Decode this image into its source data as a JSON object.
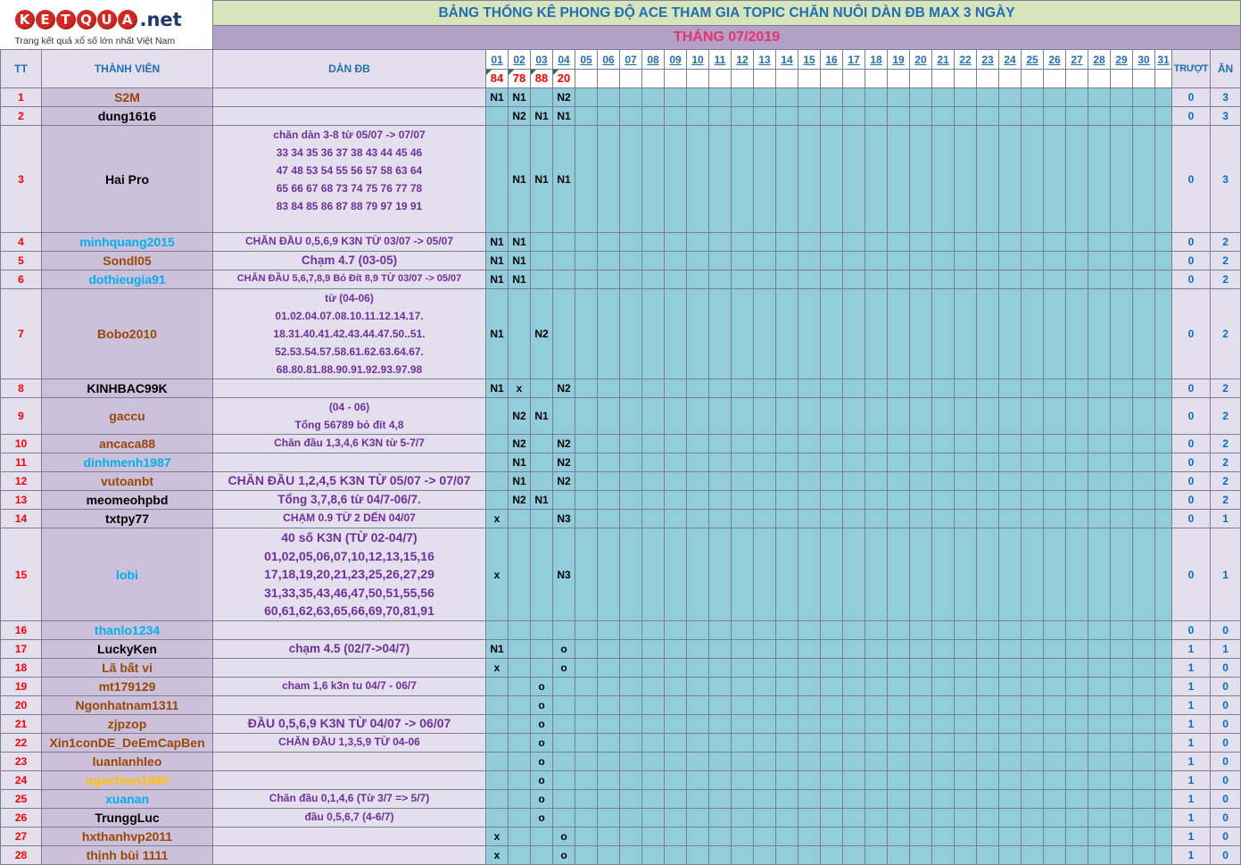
{
  "logo": {
    "letters": [
      "K",
      "E",
      "T",
      "Q",
      "U",
      "A"
    ],
    "tld": ".net",
    "tagline": "Trang kết quả xổ số lớn nhất Việt Nam"
  },
  "title": "BẢNG THỐNG KÊ PHONG ĐỘ ACE THAM GIA TOPIC CHĂN NUÔI DÀN ĐB MAX 3 NGÀY",
  "month": "THÁNG 07/2019",
  "headers": {
    "tt": "TT",
    "member": "THÀNH VIÊN",
    "dan": "DÀN ĐB",
    "miss": "TRƯỢT",
    "hit": "ĂN"
  },
  "days": [
    "01",
    "02",
    "03",
    "04",
    "05",
    "06",
    "07",
    "08",
    "09",
    "10",
    "11",
    "12",
    "13",
    "14",
    "15",
    "16",
    "17",
    "18",
    "19",
    "20",
    "21",
    "22",
    "23",
    "24",
    "25",
    "26",
    "27",
    "28",
    "29",
    "30",
    "31"
  ],
  "results": [
    "84",
    "78",
    "88",
    "20"
  ],
  "rows": [
    {
      "tt": "1",
      "member": "S2M",
      "color": "#984807",
      "dan": [],
      "marks": [
        "N1",
        "N1",
        "",
        "N2"
      ],
      "miss": "0",
      "hit": "3"
    },
    {
      "tt": "2",
      "member": "dung1616",
      "color": "#000000",
      "dan": [],
      "marks": [
        "",
        "N2",
        "N1",
        "N1"
      ],
      "miss": "0",
      "hit": "3"
    },
    {
      "tt": "3",
      "member": "Hai Pro",
      "color": "#000000",
      "dan": [
        "chăn dàn 3-8 từ 05/07 -> 07/07",
        "33 34 35 36 37 38 43 44 45 46",
        "47 48 53 54 55 56 57 58 63 64",
        "65 66 67 68 73 74 75 76 77 78",
        "83 84 85 86 87 88 79 97 19 91"
      ],
      "marks": [
        "",
        "N1",
        "N1",
        "N1"
      ],
      "miss": "0",
      "hit": "3"
    },
    {
      "tt": "4",
      "member": "minhquang2015",
      "color": "#00b0f0",
      "dan": [
        "CHĂN ĐẦU 0,5,6,9 K3N TỪ 03/07 -> 05/07"
      ],
      "marks": [
        "N1",
        "N1",
        "",
        ""
      ],
      "miss": "0",
      "hit": "2"
    },
    {
      "tt": "5",
      "member": "Sondl05",
      "color": "#984807",
      "dan": [
        "Chạm 4.7 (03-05)"
      ],
      "marks": [
        "N1",
        "N1",
        "",
        ""
      ],
      "miss": "0",
      "hit": "2"
    },
    {
      "tt": "6",
      "member": "dothieugia91",
      "color": "#00b0f0",
      "dan": [
        "CHĂN ĐẦU 5,6,7,8,9 Bỏ Đít 8,9 TỪ 03/07 -> 05/07"
      ],
      "marks": [
        "N1",
        "N1",
        "",
        ""
      ],
      "miss": "0",
      "hit": "2"
    },
    {
      "tt": "7",
      "member": "Bobo2010",
      "color": "#984807",
      "dan": [
        "từ (04-06)",
        "01.02.04.07.08.10.11.12.14.17.",
        "18.31.40.41.42.43.44.47.50..51.",
        "52.53.54.57.58.61.62.63.64.67.",
        "68.80.81.88.90.91.92.93.97.98"
      ],
      "marks": [
        "N1",
        "",
        "N2",
        ""
      ],
      "miss": "0",
      "hit": "2"
    },
    {
      "tt": "8",
      "member": "KINHBAC99K",
      "color": "#000000",
      "dan": [],
      "marks": [
        "N1",
        "x",
        "",
        "N2"
      ],
      "miss": "0",
      "hit": "2"
    },
    {
      "tt": "9",
      "member": "gaccu",
      "color": "#984807",
      "dan": [
        "(04 - 06)",
        "Tổng 56789 bỏ đít 4,8"
      ],
      "marks": [
        "",
        "N2",
        "N1",
        ""
      ],
      "miss": "0",
      "hit": "2"
    },
    {
      "tt": "10",
      "member": "ancaca88",
      "color": "#984807",
      "dan": [
        "Chăn đầu 1,3,4,6 K3N từ 5-7/7"
      ],
      "marks": [
        "",
        "N2",
        "",
        "N2"
      ],
      "miss": "0",
      "hit": "2"
    },
    {
      "tt": "11",
      "member": "dinhmenh1987",
      "color": "#00b0f0",
      "dan": [],
      "marks": [
        "",
        "N1",
        "",
        "N2"
      ],
      "miss": "0",
      "hit": "2"
    },
    {
      "tt": "12",
      "member": "vutoanbt",
      "color": "#984807",
      "dan": [
        "CHĂN ĐẦU 1,2,4,5 K3N TỪ 05/07 -> 07/07"
      ],
      "marks": [
        "",
        "N1",
        "",
        "N2"
      ],
      "miss": "0",
      "hit": "2"
    },
    {
      "tt": "13",
      "member": "meomeohpbd",
      "color": "#000000",
      "dan": [
        "Tổng 3,7,8,6 từ 04/7-06/7."
      ],
      "marks": [
        "",
        "N2",
        "N1",
        ""
      ],
      "miss": "0",
      "hit": "2"
    },
    {
      "tt": "14",
      "member": "txtpy77",
      "color": "#000000",
      "dan": [
        "CHẠM 0.9 TỪ 2 DẾN 04/07"
      ],
      "marks": [
        "x",
        "",
        "",
        "N3"
      ],
      "miss": "0",
      "hit": "1"
    },
    {
      "tt": "15",
      "member": "lobi",
      "color": "#00b0f0",
      "dan": [
        "40 số K3N (TỪ 02-04/7)",
        "01,02,05,06,07,10,12,13,15,16",
        "17,18,19,20,21,23,25,26,27,29",
        "31,33,35,43,46,47,50,51,55,56",
        "60,61,62,63,65,66,69,70,81,91"
      ],
      "marks": [
        "x",
        "",
        "",
        "N3"
      ],
      "miss": "0",
      "hit": "1"
    },
    {
      "tt": "16",
      "member": "thanlo1234",
      "color": "#00b0f0",
      "dan": [],
      "marks": [
        "",
        "",
        "",
        ""
      ],
      "miss": "0",
      "hit": "0"
    },
    {
      "tt": "17",
      "member": "LuckyKen",
      "color": "#000000",
      "dan": [
        "chạm 4.5 (02/7->04/7)"
      ],
      "marks": [
        "N1",
        "",
        "",
        "o"
      ],
      "miss": "1",
      "hit": "1"
    },
    {
      "tt": "18",
      "member": "Lã bất vi",
      "color": "#984807",
      "dan": [],
      "marks": [
        "x",
        "",
        "",
        "o"
      ],
      "miss": "1",
      "hit": "0"
    },
    {
      "tt": "19",
      "member": "mt179129",
      "color": "#984807",
      "dan": [
        "cham 1,6 k3n tu 04/7 - 06/7"
      ],
      "marks": [
        "",
        "",
        "o",
        ""
      ],
      "miss": "1",
      "hit": "0"
    },
    {
      "tt": "20",
      "member": "Ngonhatnam1311",
      "color": "#984807",
      "dan": [],
      "marks": [
        "",
        "",
        "o",
        ""
      ],
      "miss": "1",
      "hit": "0"
    },
    {
      "tt": "21",
      "member": "zjpzop",
      "color": "#984807",
      "dan": [
        "ĐẦU 0,5,6,9 K3N TỪ 04/07 -> 06/07"
      ],
      "marks": [
        "",
        "",
        "o",
        ""
      ],
      "miss": "1",
      "hit": "0"
    },
    {
      "tt": "22",
      "member": "Xin1conDE_DeEmCapBen",
      "color": "#984807",
      "dan": [
        "CHĂN ĐẦU 1,3,5,9 TỪ 04-06"
      ],
      "marks": [
        "",
        "",
        "o",
        ""
      ],
      "miss": "1",
      "hit": "0"
    },
    {
      "tt": "23",
      "member": "luanlanhleo",
      "color": "#984807",
      "dan": [],
      "marks": [
        "",
        "",
        "o",
        ""
      ],
      "miss": "1",
      "hit": "0"
    },
    {
      "tt": "24",
      "member": "ngochien1980",
      "color": "#ffc000",
      "dan": [],
      "marks": [
        "",
        "",
        "o",
        ""
      ],
      "miss": "1",
      "hit": "0"
    },
    {
      "tt": "25",
      "member": "xuanan",
      "color": "#00b0f0",
      "dan": [
        "Chăn đầu 0,1,4,6 (Từ 3/7 => 5/7)"
      ],
      "marks": [
        "",
        "",
        "o",
        ""
      ],
      "miss": "1",
      "hit": "0"
    },
    {
      "tt": "26",
      "member": "TrunggLuc",
      "color": "#000000",
      "dan": [
        "đầu 0,5,6,7 (4-6/7)"
      ],
      "marks": [
        "",
        "",
        "o",
        ""
      ],
      "miss": "1",
      "hit": "0"
    },
    {
      "tt": "27",
      "member": "hxthanhvp2011",
      "color": "#984807",
      "dan": [],
      "marks": [
        "x",
        "",
        "",
        "o"
      ],
      "miss": "1",
      "hit": "0"
    },
    {
      "tt": "28",
      "member": "thịnh bùi 1111",
      "color": "#984807",
      "dan": [],
      "marks": [
        "x",
        "",
        "",
        "o"
      ],
      "miss": "1",
      "hit": "0"
    }
  ]
}
